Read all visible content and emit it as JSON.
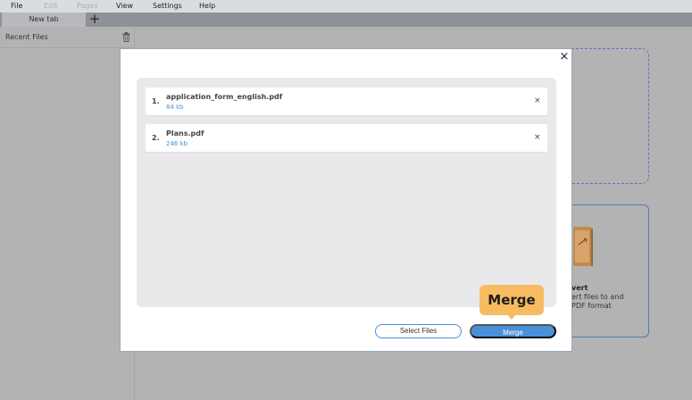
{
  "menu": [
    {
      "label": "File",
      "enabled": true
    },
    {
      "label": "Edit",
      "enabled": false
    },
    {
      "label": "Pages",
      "enabled": false
    },
    {
      "label": "View",
      "enabled": true
    },
    {
      "label": "Settings",
      "enabled": true
    },
    {
      "label": "Help",
      "enabled": true
    }
  ],
  "tabs": {
    "active_label": "New tab",
    "new_tab_glyph": "+"
  },
  "sidebar": {
    "title": "Recent Files",
    "trash_icon": "trash-icon"
  },
  "background_card": {
    "title": "vert",
    "desc": "ert files to and\nPDF format"
  },
  "modal": {
    "close_glyph": "×",
    "files": [
      {
        "index": "1.",
        "name": "application_form_english.pdf",
        "size": "84 kb",
        "remove_glyph": "×"
      },
      {
        "index": "2.",
        "name": "Plans.pdf",
        "size": "246 kb",
        "remove_glyph": "×"
      }
    ],
    "select_label": "Select Files",
    "merge_label": "Merge"
  },
  "tooltip": {
    "label": "Merge"
  },
  "colors": {
    "accent": "#4a90d9",
    "tooltip": "#f7bc61",
    "modal_bg": "#ffffff",
    "overlay": "#b3b3b3"
  }
}
